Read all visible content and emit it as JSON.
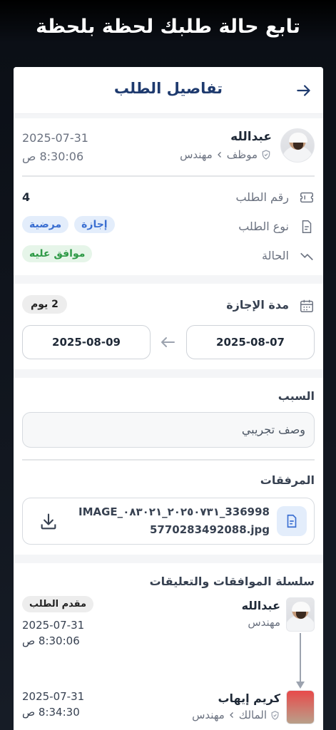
{
  "hero_text": "تابع حالة طلبك لحظة بلحظة",
  "header": {
    "title": "تفاصيل الطلب"
  },
  "requester": {
    "name": "عبدالله",
    "role": "موظف",
    "title": "مهندس",
    "date": "2025-07-31",
    "time": "8:30:06 ص"
  },
  "info": {
    "request_number_label": "رقم الطلب",
    "request_number": "4",
    "request_type_label": "نوع الطلب",
    "request_type_tags": [
      "إجازة",
      "مرضية"
    ],
    "status_label": "الحالة",
    "status_value": "موافق عليه"
  },
  "leave": {
    "duration_label": "مدة الإجازة",
    "duration_value": "2 يوم",
    "start_date": "2025-08-07",
    "end_date": "2025-08-09"
  },
  "reason": {
    "label": "السبب",
    "value": "وصف تجريبي"
  },
  "attachments": {
    "label": "المرفقات",
    "file_line1": "IMAGE_٢٠٢٥٠٧٣١_٠٨٣٠٢١_336998",
    "file_line2": "5770283492088.jpg"
  },
  "chain": {
    "title": "سلسلة الموافقات والتعليقات",
    "entries": [
      {
        "name": "عبدالله",
        "title": "مهندس",
        "badge": "مقدم الطلب",
        "date": "2025-07-31",
        "time": "8:30:06 ص"
      },
      {
        "name": "كريم إيهاب",
        "role": "المالك",
        "title": "مهندس",
        "date": "2025-07-31",
        "time": "8:34:30 ص"
      }
    ]
  },
  "colors": {
    "accent": "#1e3a6e",
    "tag_blue": "#3b6fd1",
    "tag_green": "#2f9a47"
  }
}
